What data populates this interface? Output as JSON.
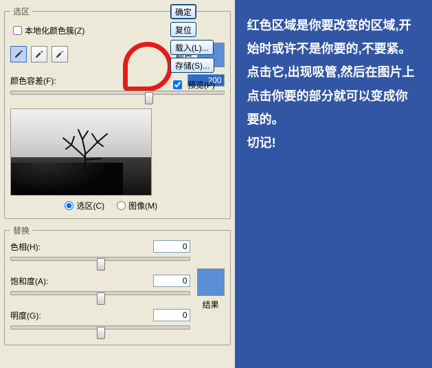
{
  "selection": {
    "legend": "选区",
    "localize": "本地化颜色簇(Z)",
    "color_label": "颜色:",
    "fuzz_label": "颜色容差(F):",
    "fuzz_value": "200",
    "radio_sel": "选区(C)",
    "radio_img": "图像(M)",
    "swatch": "#5a8fd6"
  },
  "replace": {
    "legend": "替换",
    "hue_label": "色相(H):",
    "hue_value": "0",
    "sat_label": "饱和度(A):",
    "sat_value": "0",
    "lig_label": "明度(G):",
    "lig_value": "0",
    "result": "结果",
    "swatch": "#5a8fd6"
  },
  "buttons": {
    "ok": "确定",
    "reset": "复位",
    "load": "载入(L)...",
    "save": "存储(S)...",
    "preview": "预览(P)"
  },
  "note": "红色区域是你要改变的区域,开始时或许不是你要的,不要紧。点击它,出现吸管,然后在图片上点击你要的部分就可以变成你要的。\n切记!"
}
